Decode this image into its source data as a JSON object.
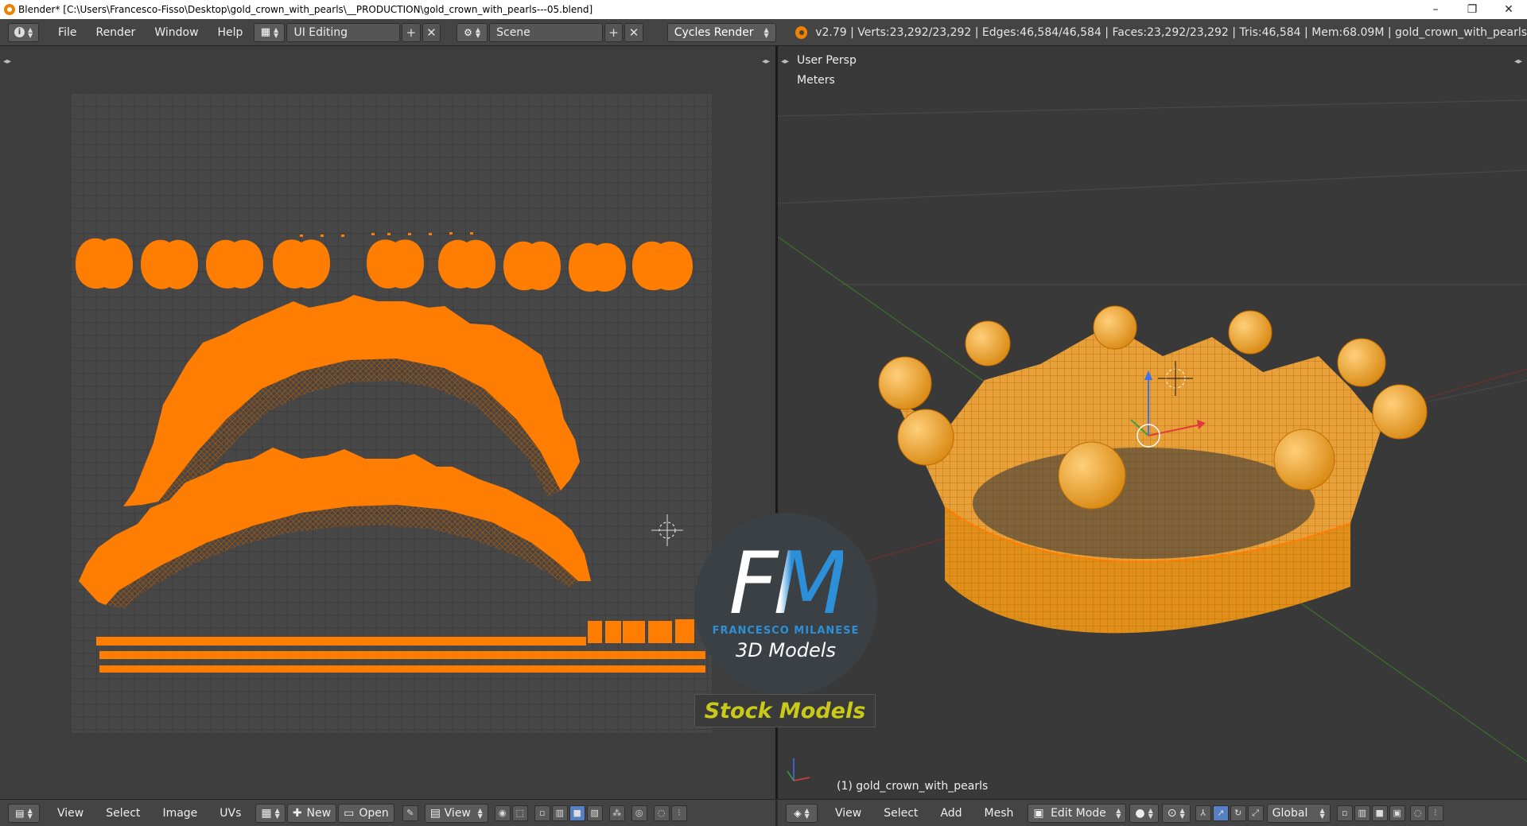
{
  "window": {
    "title": "Blender* [C:\\Users\\Francesco-Fisso\\Desktop\\gold_crown_with_pearls\\__PRODUCTION\\gold_crown_with_pearls---05.blend]",
    "minimize": "–",
    "maximize": "❐",
    "close": "✕"
  },
  "infobar": {
    "menus": [
      "File",
      "Render",
      "Window",
      "Help"
    ],
    "screen_layout": "UI Editing",
    "scene": "Scene",
    "render_engine": "Cycles Render",
    "stats": "v2.79 | Verts:23,292/23,292 | Edges:46,584/46,584 | Faces:23,292/23,292 | Tris:46,584 | Mem:68.09M | gold_crown_with_pearls",
    "add_icon": "+",
    "close_icon": "✕"
  },
  "uv_editor": {
    "menus": [
      "View",
      "Select",
      "Image",
      "UVs"
    ],
    "new_label": "New",
    "open_label": "Open",
    "view_label": "View"
  },
  "viewport": {
    "projection": "User Persp",
    "units": "Meters",
    "object_label": "(1) gold_crown_with_pearls",
    "menus": [
      "View",
      "Select",
      "Add",
      "Mesh"
    ],
    "mode": "Edit Mode",
    "orientation": "Global"
  },
  "watermark": {
    "monogram": "FM",
    "author": "FRANCESCO MILANESE",
    "subtitle": "3D Models",
    "banner": "Stock Models"
  },
  "colors": {
    "uv_orange": "#ff7d00",
    "accent_blue": "#5680c2",
    "brand_yellow": "#c9c91a"
  }
}
